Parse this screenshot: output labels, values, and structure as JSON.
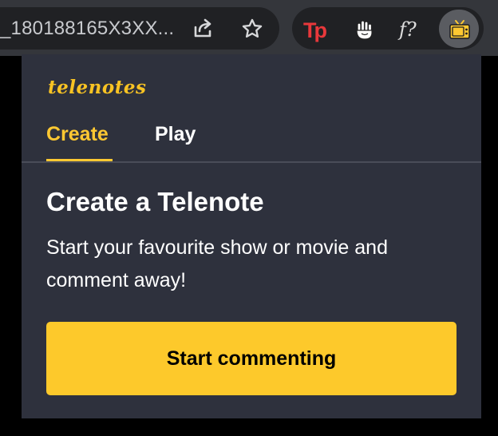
{
  "browser": {
    "address_bar": {
      "url_text": "_180188165X3XX..."
    },
    "icons": {
      "share": "share-icon",
      "bookmark": "star-icon"
    },
    "extensions": [
      {
        "name": "tp-extension",
        "label": "Tp"
      },
      {
        "name": "hand-extension",
        "icon": "hand-icon"
      },
      {
        "name": "font-query-extension",
        "label": "f?"
      },
      {
        "name": "telenotes-extension",
        "icon": "tv-icon",
        "active": true
      }
    ]
  },
  "popup": {
    "logo": "telenotes",
    "tabs": [
      {
        "label": "Create",
        "active": true
      },
      {
        "label": "Play",
        "active": false
      }
    ],
    "heading": "Create a Telenote",
    "description": "Start your favourite show or movie and comment away!",
    "cta_label": "Start commenting"
  },
  "colors": {
    "accent": "#fdc832",
    "popup_bg": "#2e313d",
    "toolbar_bg": "#34363b",
    "text": "#ffffff"
  }
}
